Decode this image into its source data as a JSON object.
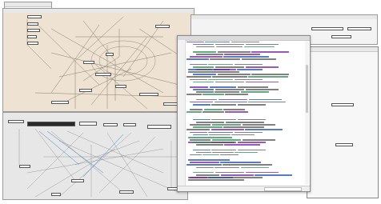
{
  "windows": {
    "main_patch": {
      "title": ""
    },
    "bottom_patch": {
      "title": ""
    },
    "code_editor": {
      "title": ""
    },
    "right_patch": {
      "title": ""
    },
    "right_lower_panel": {
      "title": ""
    }
  },
  "colors": {
    "main_patch_bg": "#eee2d3",
    "bottom_patch_bg": "#e7e7e7",
    "editor_bg": "#ffffff",
    "keyword": "#7a1fa2",
    "type": "#1f4fb0",
    "comment": "#2e8b57",
    "plain": "#555555"
  },
  "icons": [
    "close-icon",
    "minimize-icon",
    "maximize-icon",
    "scroll-thumb"
  ]
}
